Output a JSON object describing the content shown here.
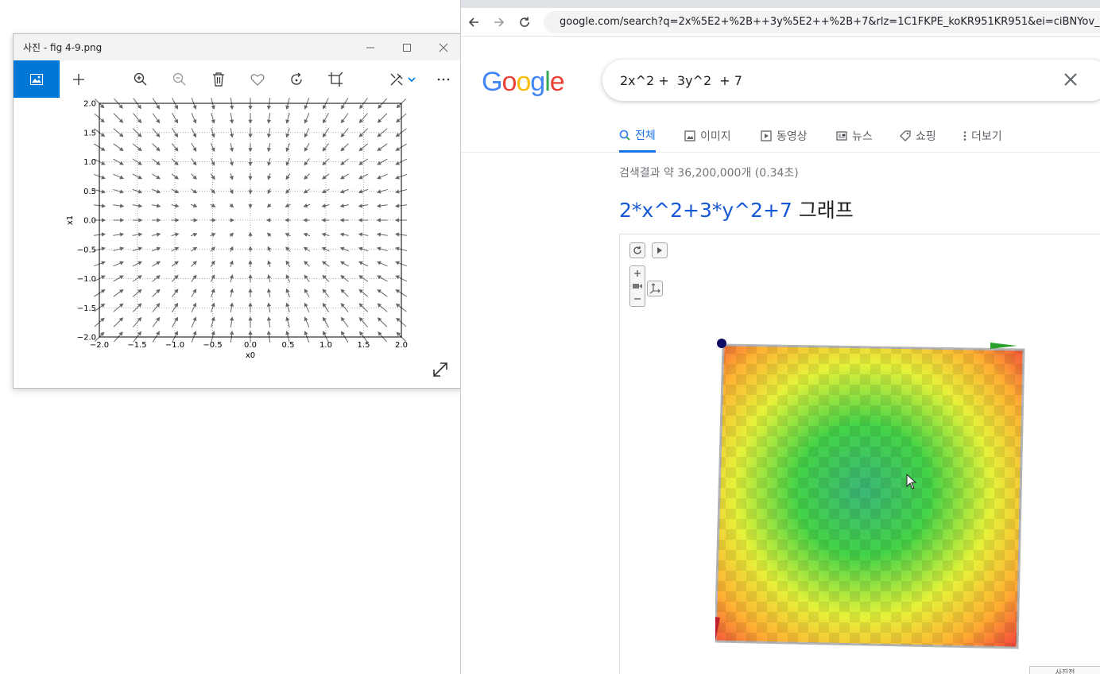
{
  "photos_window": {
    "title": "사진 - fig 4-9.png",
    "toolbar": [
      "view-all",
      "add",
      "zoom-in",
      "zoom-out",
      "delete",
      "favorite",
      "rotate",
      "crop",
      "edit",
      "more"
    ],
    "controls": {
      "minimize": "—",
      "maximize": "☐",
      "close": "✕"
    }
  },
  "browser": {
    "url": "google.com/search?q=2x%5E2+%2B++3y%5E2++%2B+7&rlz=1C1FKPE_koKR951KR951&ei=ciBNYov_Oc",
    "logo": "Google",
    "query": "2x^2 +  3y^2  + 7",
    "tabs": [
      {
        "label": "전체",
        "icon": "search-icon",
        "selected": true
      },
      {
        "label": "이미지",
        "icon": "image-icon",
        "selected": false
      },
      {
        "label": "동영상",
        "icon": "video-icon",
        "selected": false
      },
      {
        "label": "뉴스",
        "icon": "news-icon",
        "selected": false
      },
      {
        "label": "쇼핑",
        "icon": "tag-icon",
        "selected": false
      },
      {
        "label": "더보기",
        "icon": "more-icon",
        "selected": false
      }
    ],
    "result_stats": "검색결과 약 36,200,000개 (0.34초)",
    "graph_title_expr": "2*x^2+3*y^2+7",
    "graph_title_suffix": " 그래프",
    "share_label": "사진전"
  },
  "chart_data": {
    "type": "quiver",
    "title": "",
    "xlabel": "x0",
    "ylabel": "x1",
    "xlim": [
      -2.0,
      2.0
    ],
    "ylim": [
      -2.0,
      2.0
    ],
    "xticks": [
      "−2.0",
      "−1.5",
      "−1.0",
      "−0.5",
      "0.0",
      "0.5",
      "1.0",
      "1.5",
      "2.0"
    ],
    "yticks": [
      "2.0",
      "1.5",
      "1.0",
      "0.5",
      "0.0",
      "−0.5",
      "−1.0",
      "−1.5",
      "−2.0"
    ],
    "grid": true,
    "grid_step": 0.25,
    "field": "negative gradient pointing toward origin",
    "arrow_color": "#666666"
  },
  "colors": {
    "accent_blue": "#0078d7",
    "google_blue": "#4285f4",
    "google_red": "#ea4335",
    "google_yellow": "#fbbc05",
    "google_green": "#34a853"
  }
}
